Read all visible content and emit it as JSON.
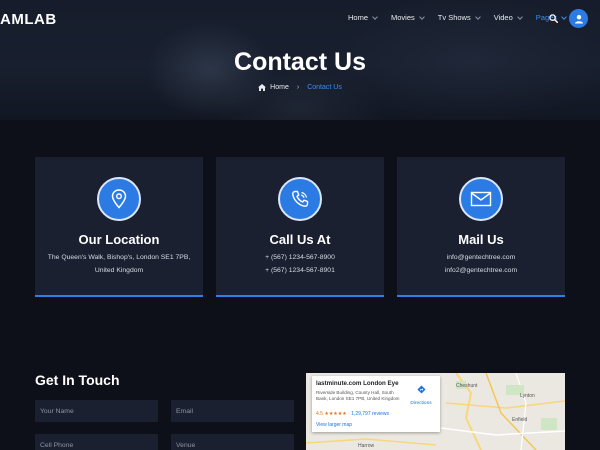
{
  "brand": {
    "logo_text": "AMLAB"
  },
  "nav": {
    "items": [
      {
        "label": "Home",
        "active": false
      },
      {
        "label": "Movies",
        "active": false
      },
      {
        "label": "Tv Shows",
        "active": false
      },
      {
        "label": "Video",
        "active": false
      },
      {
        "label": "Pages",
        "active": true
      }
    ],
    "search_icon": "search-icon",
    "avatar_icon": "user-icon"
  },
  "hero": {
    "title": "Contact Us",
    "breadcrumb": {
      "home": "Home",
      "current": "Contact Us",
      "home_icon": "home-icon"
    }
  },
  "cards": [
    {
      "icon": "location-pin-icon",
      "title": "Our Location",
      "line1": "The Queen's Walk, Bishop's, London SE1 7PB,",
      "line2": "United Kingdom"
    },
    {
      "icon": "phone-icon",
      "title": "Call Us At",
      "line1": "+ (567) 1234-567-8900",
      "line2": "+ (567) 1234-567-8901"
    },
    {
      "icon": "mail-icon",
      "title": "Mail Us",
      "line1": "info@gentechtree.com",
      "line2": "info2@gentechtree.com"
    }
  ],
  "form": {
    "title": "Get In Touch",
    "name_placeholder": "Your Name",
    "email_placeholder": "Email",
    "phone_placeholder": "Cell Phone",
    "venue_placeholder": "Venue"
  },
  "map": {
    "place_name": "lastminute.com London Eye",
    "address": "Riverside Building, County Hall, South Bank, London SE1 7PB, United Kingdom",
    "rating": "4.5",
    "stars": "★★★★★",
    "reviews": "1,29,797 reviews",
    "directions_label": "Directions",
    "larger_map_link": "View larger map",
    "labels": [
      "Cheshunt",
      "Lynton",
      "Enfield",
      "Harrow"
    ]
  },
  "colors": {
    "accent": "#2c7be5",
    "active_nav": "#3a8ef6",
    "card_bg": "#1a2030",
    "page_bg": "#0d1018"
  }
}
